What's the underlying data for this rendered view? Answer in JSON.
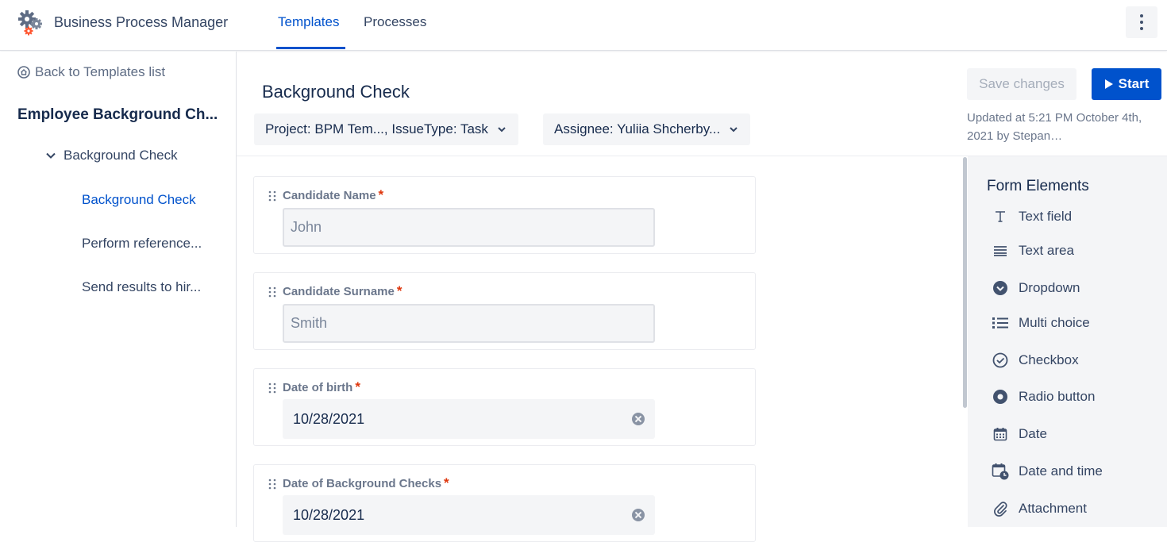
{
  "header": {
    "app_title": "Business Process Manager",
    "tabs": [
      {
        "label": "Templates",
        "active": true
      },
      {
        "label": "Processes",
        "active": false
      }
    ]
  },
  "sidebar": {
    "back_label": "Back to Templates list",
    "template_name": "Employee Background Ch...",
    "group_label": "Background Check",
    "items": [
      {
        "label": "Background Check",
        "active": true
      },
      {
        "label": "Perform reference...",
        "active": false
      },
      {
        "label": "Send results to hir...",
        "active": false
      }
    ]
  },
  "main": {
    "title": "Background Check",
    "project_selector": "Project: BPM Tem..., IssueType: Task",
    "assignee_selector": "Assignee: Yuliia Shcherby...",
    "save_label": "Save changes",
    "start_label": "Start",
    "updated_text": "Updated at 5:21 PM October 4th, 2021 by Stepan…",
    "fields": [
      {
        "label": "Candidate Name",
        "required": "*",
        "type": "text",
        "placeholder": "John"
      },
      {
        "label": "Candidate Surname",
        "required": "*",
        "type": "text",
        "placeholder": "Smith"
      },
      {
        "label": "Date of birth",
        "required": "*",
        "type": "date",
        "value": "10/28/2021"
      },
      {
        "label": "Date of Background Checks",
        "required": "*",
        "type": "date",
        "value": "10/28/2021"
      }
    ]
  },
  "form_elements": {
    "title": "Form Elements",
    "items": [
      {
        "label": "Text field",
        "icon": "text-field-icon"
      },
      {
        "label": "Text area",
        "icon": "text-area-icon"
      },
      {
        "label": "Dropdown",
        "icon": "dropdown-icon"
      },
      {
        "label": "Multi choice",
        "icon": "multi-choice-icon"
      },
      {
        "label": "Checkbox",
        "icon": "checkbox-icon"
      },
      {
        "label": "Radio button",
        "icon": "radio-button-icon"
      },
      {
        "label": "Date",
        "icon": "calendar-icon"
      },
      {
        "label": "Date and time",
        "icon": "calendar-clock-icon"
      },
      {
        "label": "Attachment",
        "icon": "paperclip-icon"
      }
    ]
  },
  "colors": {
    "primary": "#0052cc",
    "text": "#172b4d",
    "subtle": "#6b778c",
    "panel": "#f4f5f7",
    "required": "#de350b"
  }
}
